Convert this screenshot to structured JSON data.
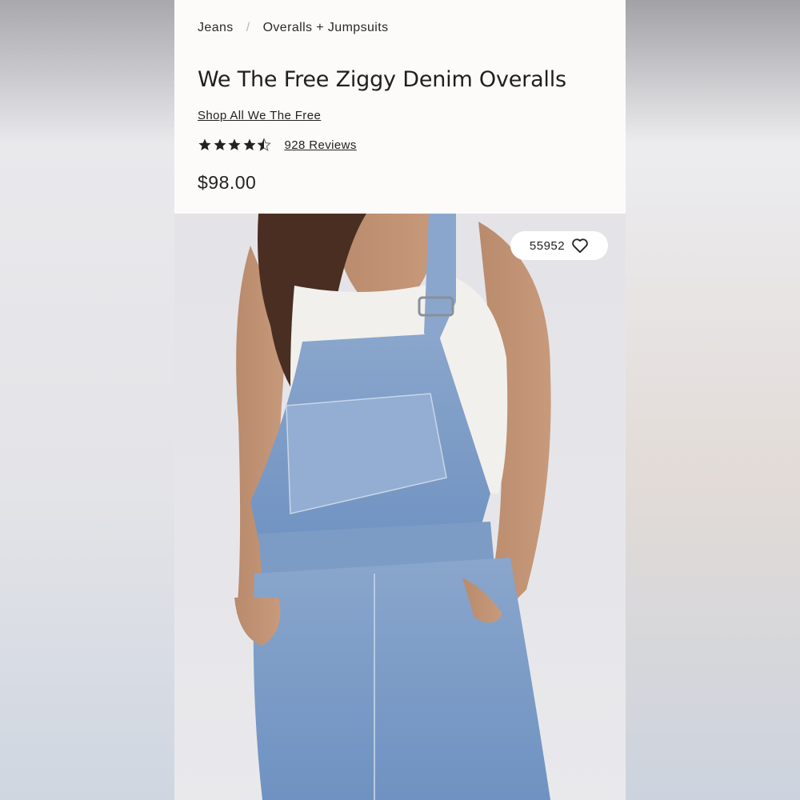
{
  "breadcrumb": {
    "items": [
      "Jeans",
      "Overalls + Jumpsuits"
    ],
    "separator": "/"
  },
  "product": {
    "title": "We The Free Ziggy Denim Overalls",
    "shop_link": "Shop All We The Free",
    "rating": 4.5,
    "reviews_label": "928 Reviews",
    "price": "$98.00"
  },
  "favorites": {
    "count": "55952",
    "icon": "heart-icon"
  },
  "colors": {
    "header_bg": "#fcfbfa",
    "text": "#222222",
    "denim": "#7e9ec8"
  }
}
